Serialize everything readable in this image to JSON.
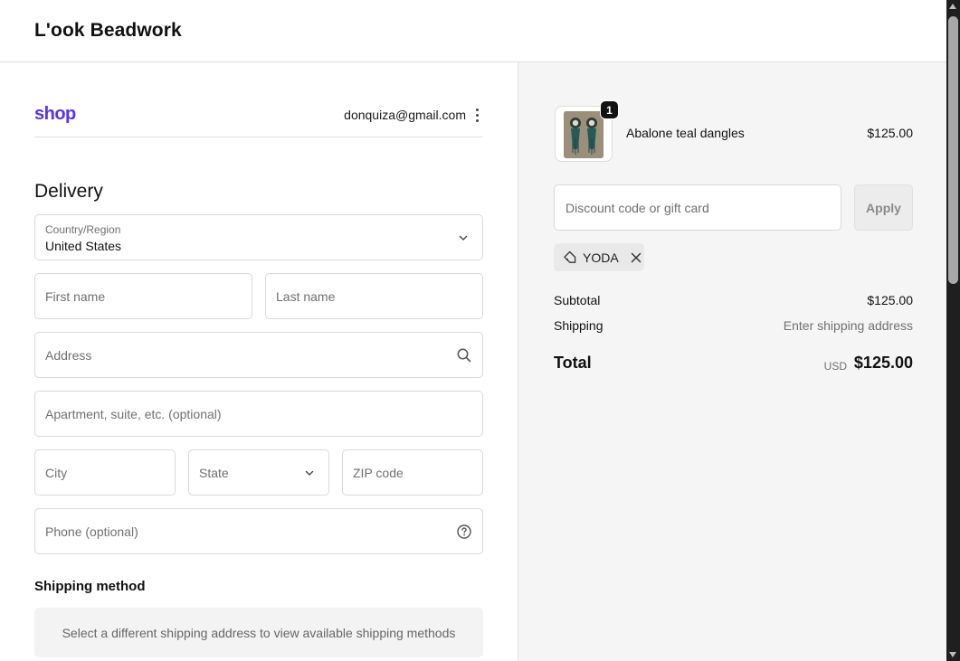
{
  "header": {
    "store_name": "L'ook Beadwork"
  },
  "account": {
    "shop_logo": "shop",
    "email": "donquiza@gmail.com"
  },
  "delivery": {
    "title": "Delivery",
    "country_label": "Country/Region",
    "country_value": "United States",
    "first_name_placeholder": "First name",
    "last_name_placeholder": "Last name",
    "address_placeholder": "Address",
    "apartment_placeholder": "Apartment, suite, etc. (optional)",
    "city_placeholder": "City",
    "state_placeholder": "State",
    "zip_placeholder": "ZIP code",
    "phone_placeholder": "Phone (optional)"
  },
  "shipping_method": {
    "title": "Shipping method",
    "message": "Select a different shipping address to view available shipping methods"
  },
  "order": {
    "item": {
      "name": "Abalone teal dangles",
      "price": "$125.00",
      "quantity": "1"
    },
    "discount_placeholder": "Discount code or gift card",
    "apply_label": "Apply",
    "applied_code": "YODA",
    "subtotal_label": "Subtotal",
    "subtotal_value": "$125.00",
    "shipping_label": "Shipping",
    "shipping_value": "Enter shipping address",
    "total_label": "Total",
    "total_currency": "USD",
    "total_value": "$125.00"
  },
  "icons": {
    "account_menu": "kebab-menu-icon",
    "country_chevron": "chevron-down-icon",
    "address_search": "search-icon",
    "state_chevron": "chevron-down-icon",
    "phone_help": "question-circle-icon",
    "discount_tag": "tag-icon",
    "discount_remove": "close-icon"
  },
  "colors": {
    "shop_brand": "#5a31f4",
    "summary_background": "#f5f5f5",
    "badge_background": "#111111"
  }
}
